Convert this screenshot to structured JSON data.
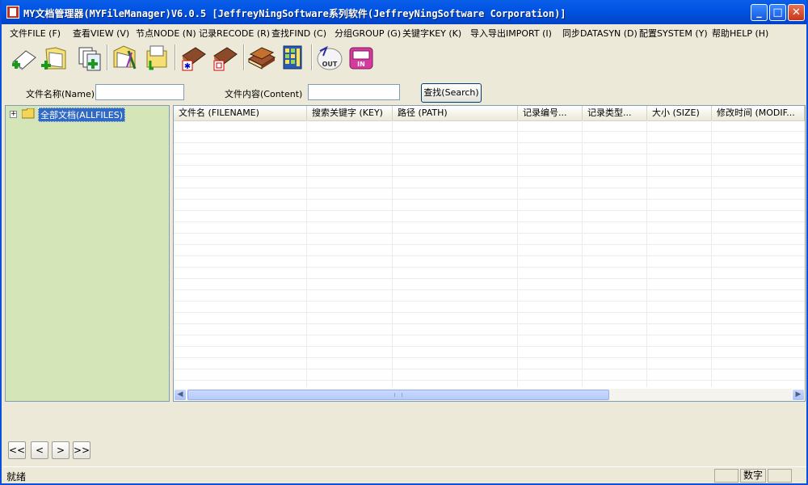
{
  "window": {
    "title": "MY文档管理器(MYFileManager)V6.0.5 [JeffreyNingSoftware系列软件(JeffreyNingSoftware Corporation)]",
    "controls": [
      "minimize",
      "maximize",
      "close"
    ]
  },
  "menu": [
    "文件FILE (F)",
    "查看VIEW (V)",
    "节点NODE (N)",
    "记录RECODE (R)",
    "查找FIND (C)",
    "分组GROUP (G)",
    "关键字KEY (K)",
    "导入导出IMPORT (I)",
    "同步DATASYN (D)",
    "配置SYSTEM (Y)",
    "帮助HELP (H)"
  ],
  "toolbar": {
    "out_label": "OUT",
    "in_label": "IN"
  },
  "search": {
    "name_label": "文件名称(Name)",
    "name_value": "",
    "content_label": "文件内容(Content)",
    "content_value": "",
    "button_label": "查找(Search)"
  },
  "tree": {
    "root_label": "全部文档(ALLFILES)",
    "expander": "+"
  },
  "list": {
    "columns": [
      "文件名 (FILENAME)",
      "搜索关键字 (KEY)",
      "路径 (PATH)",
      "记录编号...",
      "记录类型...",
      "大小 (SIZE)",
      "修改时间 (MODIF..."
    ],
    "rows": []
  },
  "pager": {
    "first": "<<",
    "prev": "<",
    "next": ">",
    "last": ">>"
  },
  "status": {
    "text": "就绪",
    "panel_num": "数字"
  },
  "colors": {
    "titlebar": "#0054e3",
    "tree_bg": "#d4e6b8",
    "selection": "#316ac5",
    "window_bg": "#ece9d8"
  }
}
